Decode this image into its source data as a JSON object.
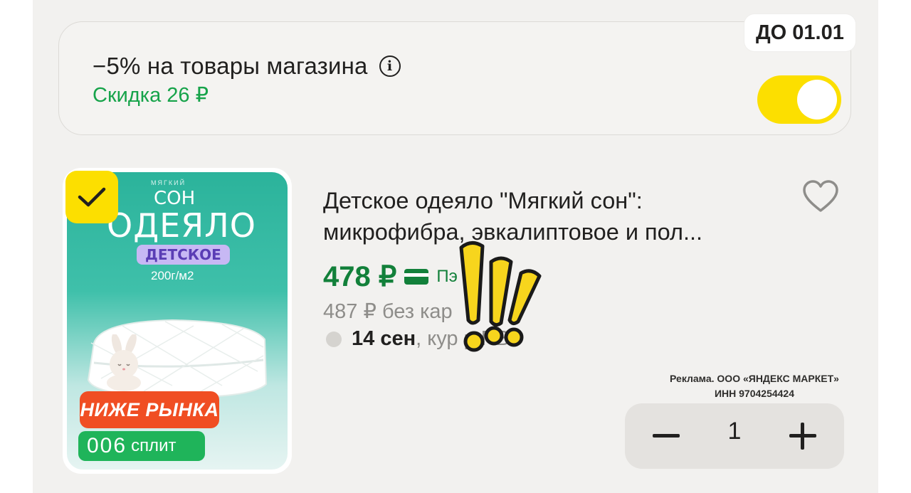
{
  "promo": {
    "title": "−5% на товары магазина",
    "discount": "Скидка 26 ₽",
    "until": "ДО 01.01",
    "enabled": true,
    "info_icon": "info-circle-icon"
  },
  "product": {
    "image": {
      "brand_small": "МЯГКИЙ",
      "brand": "СОН",
      "name": "ОДЕЯЛО",
      "kids_label": "ДЕТСКОЕ",
      "density": "200г/м2",
      "ribbon": "НИЖЕ РЫНКА",
      "split_amount": "006",
      "split_label": "сплит"
    },
    "selected": true,
    "title": "Детское одеяло \"Мягкий сон\": микрофибра, эвкалиптовое и пол...",
    "price": "478 ₽",
    "pay_method": "Пэ",
    "old_price": "487 ₽  без кар",
    "delivery_date": "14 сен",
    "delivery_rest": ", кур     р   ПВЗ",
    "favorite_icon": "heart-outline-icon",
    "ad_line1": "Реклама. ООО «ЯНДЕКС МАРКЕТ»",
    "ad_line2": "ИНН 9704254424",
    "quantity": "1"
  },
  "colors": {
    "accent_yellow": "#fcdf00",
    "green_price": "#12803a",
    "green_discount": "#16a34a",
    "ribbon_red": "#f04e23",
    "split_green": "#1fb45a"
  }
}
